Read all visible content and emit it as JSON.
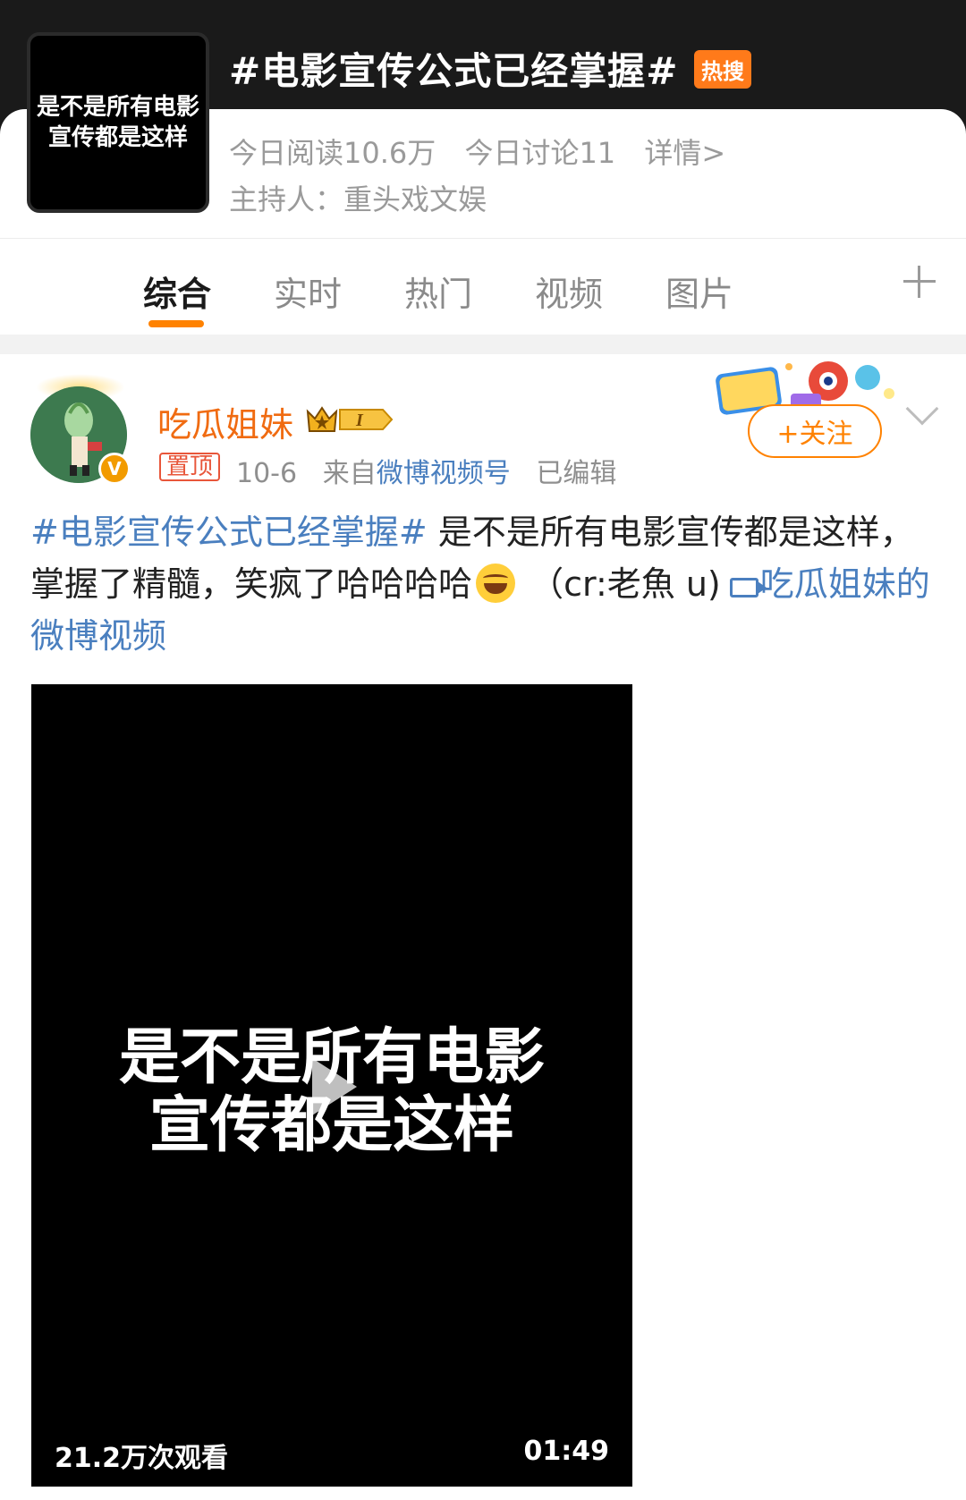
{
  "topic": {
    "thumbnail_text": "是不是所有电影\n宣传都是这样",
    "title": "#电影宣传公式已经掌握#",
    "badge": "热搜",
    "reads_today": "今日阅读10.6万",
    "discussions_today": "今日讨论11",
    "details_link": "详情>",
    "host": "主持人：重头戏文娱"
  },
  "tabs": [
    {
      "label": "综合",
      "active": true
    },
    {
      "label": "实时",
      "active": false
    },
    {
      "label": "热门",
      "active": false
    },
    {
      "label": "视频",
      "active": false
    },
    {
      "label": "图片",
      "active": false
    }
  ],
  "post": {
    "author": "吃瓜姐妹",
    "verified_badge": "V",
    "pin_label": "置顶",
    "date": "10-6",
    "from_prefix": "来自",
    "source": "微博视频号",
    "edited": "已编辑",
    "follow_label": "+关注",
    "topic_tag": "#电影宣传公式已经掌握#",
    "text_part1": " 是不是所有电影宣传都是这样，掌握了精髓，笑疯了哈哈哈哈",
    "text_part2": " （cr:老魚 u)",
    "video_link": "吃瓜姐妹的微博视频",
    "accent_color": "#ff8200",
    "link_color": "#4a7fbf"
  },
  "video": {
    "caption": "是不是所有电影\n宣传都是这样",
    "views": "21.2万次观看",
    "duration": "01:49"
  }
}
